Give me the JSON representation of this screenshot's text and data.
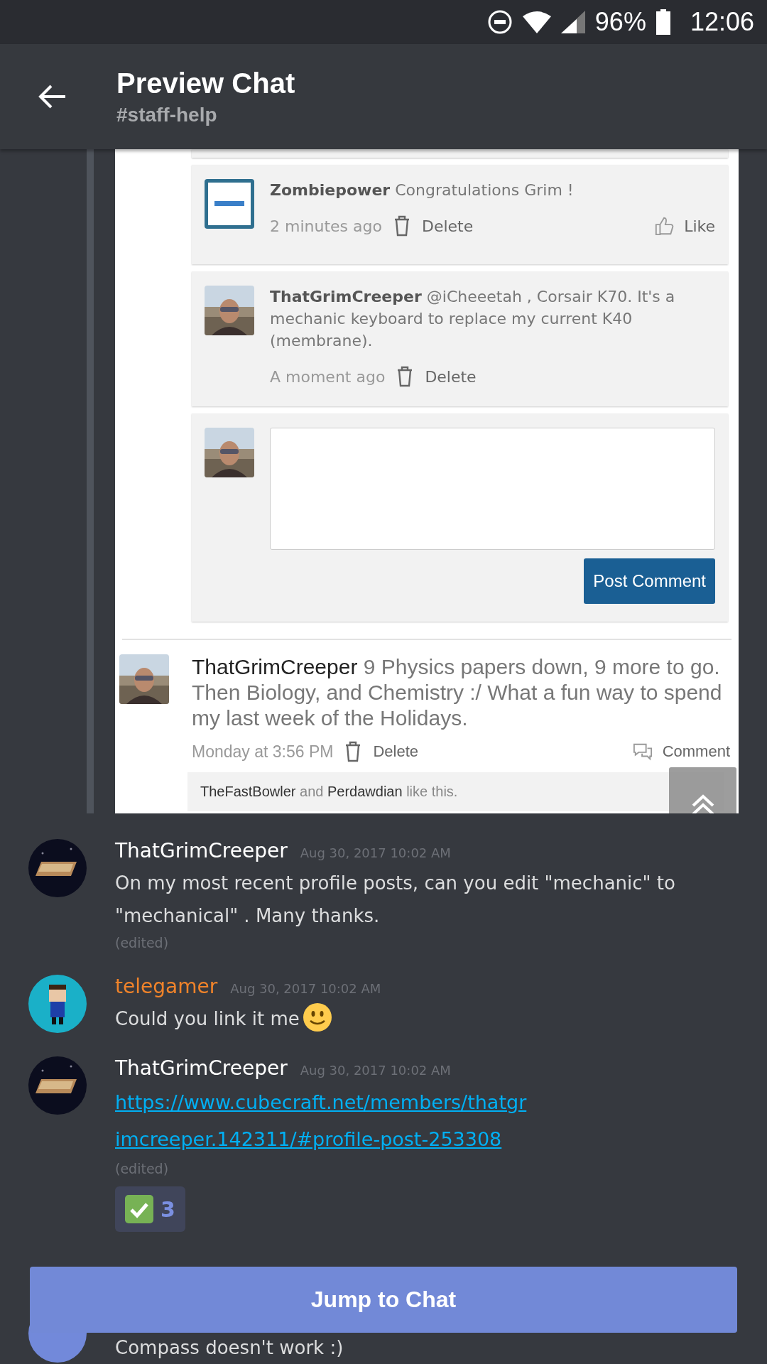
{
  "status_bar": {
    "battery": "96%",
    "time": "12:06"
  },
  "header": {
    "title": "Preview Chat",
    "subtitle": "#staff-help"
  },
  "embed": {
    "comments": [
      {
        "author": "Zombiepower",
        "text": "Congratulations Grim !",
        "time": "2 minutes ago",
        "delete": "Delete",
        "like": "Like"
      },
      {
        "author": "ThatGrimCreeper",
        "text": "@iCheeetah , Corsair K70. It's a mechanic keyboard to replace my current K40 (membrane).",
        "time": "A moment ago",
        "delete": "Delete"
      }
    ],
    "reply_button": "Post Comment",
    "post": {
      "author": "ThatGrimCreeper",
      "text": "9 Physics papers down, 9 more to go. Then Biology, and Chemistry :/ What a fun way to spend my last week of the Holidays.",
      "time": "Monday at 3:56 PM",
      "delete": "Delete",
      "comment": "Comment",
      "likes": "**TheFastBowler** and **Perdawdian** like this."
    }
  },
  "messages": [
    {
      "author": "ThatGrimCreeper",
      "color": "#ffffff",
      "timestamp": "Aug 30, 2017 10:02 AM",
      "body": [
        {
          "kind": "text",
          "text": "On my most recent profile posts, can you edit \"mechanic\" to \"mechanical\" . Many thanks."
        }
      ],
      "edited": "(edited)"
    },
    {
      "author": "telegamer",
      "color": "#f0832a",
      "timestamp": "Aug 30, 2017 10:02 AM",
      "body": [
        {
          "kind": "text",
          "text": "Could you link it me"
        },
        {
          "kind": "emoji"
        }
      ]
    },
    {
      "author": "ThatGrimCreeper",
      "color": "#ffffff",
      "timestamp": "Aug 30, 2017 10:02 AM",
      "body": [
        {
          "kind": "link",
          "text": "https://www.cubecraft.net/members/thatgrimcreeper.142311/#profile-post-253308"
        }
      ],
      "edited": "(edited)",
      "reaction": {
        "count": "3",
        "selected": true
      }
    }
  ],
  "partial_message": {
    "text": "Compass doesn't work :)"
  },
  "jump_button": "Jump to Chat"
}
